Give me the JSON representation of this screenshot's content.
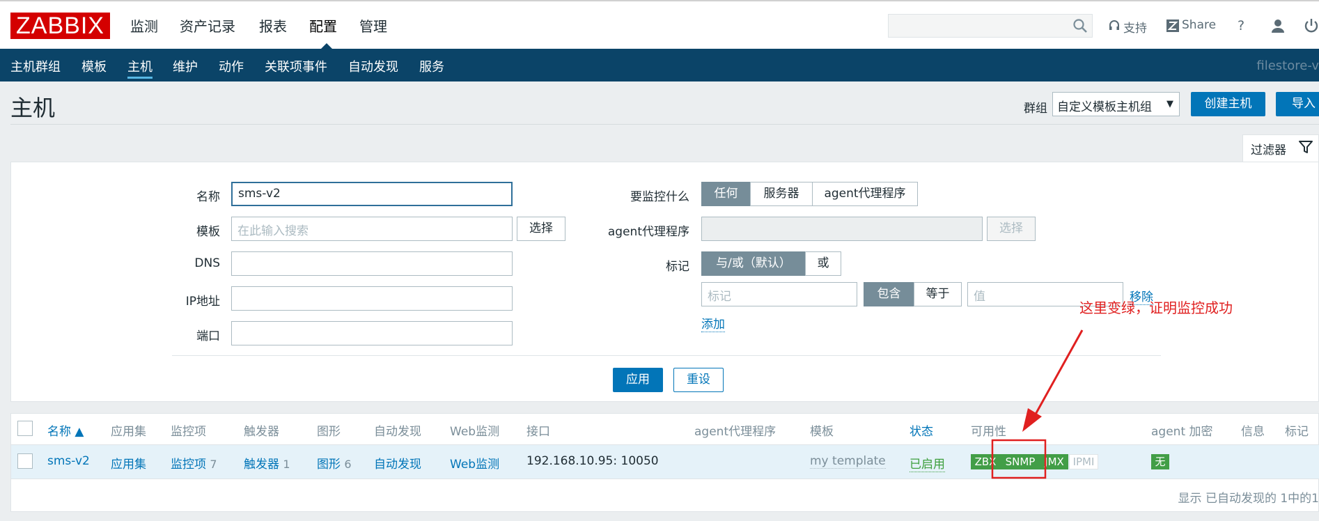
{
  "header": {
    "logo": "ZABBIX",
    "nav": [
      "监测",
      "资产记录",
      "报表",
      "配置",
      "管理"
    ],
    "active_nav": "配置",
    "links": {
      "support": "支持",
      "share": "Share",
      "help": "?"
    }
  },
  "subnav": {
    "items": [
      "主机群组",
      "模板",
      "主机",
      "维护",
      "动作",
      "关联项事件",
      "自动发现",
      "服务"
    ],
    "active": "主机",
    "right_text": "filestore-v"
  },
  "page": {
    "title": "主机",
    "group_label": "群组",
    "group_value": "自定义模板主机组",
    "create_button": "创建主机",
    "import_button": "导入"
  },
  "filter": {
    "tab_label": "过滤器",
    "name_label": "名称",
    "name_value": "sms-v2",
    "template_label": "模板",
    "template_placeholder": "在此输入搜索",
    "select_button": "选择",
    "dns_label": "DNS",
    "ip_label": "IP地址",
    "port_label": "端口",
    "monitored_label": "要监控什么",
    "monitored_options": [
      "任何",
      "服务器",
      "agent代理程序"
    ],
    "proxy_label": "agent代理程序",
    "proxy_select_button": "选择",
    "tags_label": "标记",
    "tags_logic_options": [
      "与/或（默认）",
      "或"
    ],
    "tag_placeholder": "标记",
    "tag_op_options": [
      "包含",
      "等于"
    ],
    "value_placeholder": "值",
    "remove_link": "移除",
    "add_link": "添加",
    "apply_button": "应用",
    "reset_button": "重设"
  },
  "annotation": {
    "text": "这里变绿，证明监控成功",
    "color": "#e02020"
  },
  "table": {
    "headers": [
      "名称 ▲",
      "应用集",
      "监控项",
      "触发器",
      "图形",
      "自动发现",
      "Web监测",
      "接口",
      "agent代理程序",
      "模板",
      "状态",
      "可用性",
      "agent 加密",
      "信息",
      "标记"
    ],
    "row": {
      "name": "sms-v2",
      "applications": "应用集",
      "items": "监控项",
      "items_count": "7",
      "triggers": "触发器",
      "triggers_count": "1",
      "graphs": "图形",
      "graphs_count": "6",
      "discovery": "自动发现",
      "web": "Web监测",
      "interface": "192.168.10.95: 10050",
      "template": "my template",
      "status": "已启用",
      "availability": [
        "ZBX",
        "SNMP",
        "JMX",
        "IPMI"
      ],
      "encryption": "无"
    },
    "footer": "显示 已自动发现的 1中的1"
  },
  "colors": {
    "brand_red": "#d40000",
    "nav_blue": "#0b4468",
    "accent_blue": "#0275b8",
    "available_green": "#429e47"
  }
}
